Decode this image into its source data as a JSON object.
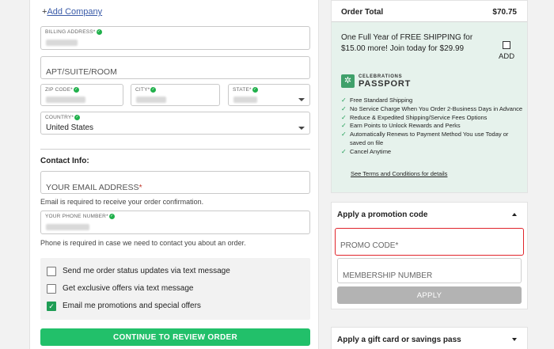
{
  "left": {
    "add_company": {
      "plus": "+",
      "label": "Add Company"
    },
    "billing_address": {
      "label": "BILLING ADDRESS*"
    },
    "apt": {
      "placeholder": "APT/SUITE/ROOM"
    },
    "zip": {
      "label": "ZIP CODE*"
    },
    "city": {
      "label": "CITY*"
    },
    "state": {
      "label": "STATE*"
    },
    "country": {
      "label": "COUNTRY*",
      "value": "United States"
    },
    "contact": {
      "title": "Contact Info:",
      "email_placeholder": "YOUR EMAIL ADDRESS",
      "required_mark": "*",
      "email_hint": "Email is required to receive your order confirmation.",
      "phone_label": "YOUR PHONE NUMBER*",
      "phone_hint": "Phone is required in case we need to contact you about an order."
    },
    "options": [
      {
        "label": "Send me order status updates via text message",
        "checked": false
      },
      {
        "label": "Get exclusive offers via text message",
        "checked": false
      },
      {
        "label": "Email me promotions and special offers",
        "checked": true
      }
    ],
    "continue_label": "CONTINUE TO REVIEW ORDER"
  },
  "right": {
    "order_total": {
      "label": "Order Total",
      "amount": "$70.75"
    },
    "shipping": {
      "text": "One Full Year of FREE SHIPPING for $15.00 more! Join today for $29.99",
      "add_label": "ADD",
      "logo_top": "CELEBRATIONS",
      "logo_bottom": "PASSPORT",
      "benefits": [
        "Free Standard Shipping",
        "No Service Charge When You Order 2-Business Days in Advance",
        "Reduce & Expedited Shipping/Service Fees Options",
        "Earn Points to Unlock Rewards and Perks",
        "Automatically Renews to Payment Method You use Today or saved on file",
        "Cancel Anytime"
      ],
      "terms": "See Terms and Conditions for details"
    },
    "promo": {
      "title": "Apply a promotion code",
      "promo_placeholder": "PROMO CODE*",
      "membership_placeholder": "MEMBERSHIP NUMBER",
      "apply_label": "APPLY"
    },
    "gift": {
      "title": "Apply a gift card or savings pass"
    }
  },
  "colors": {
    "accent_green": "#22c06a",
    "highlight_red": "#e0242b",
    "passport_bg": "#e6f2ec"
  }
}
